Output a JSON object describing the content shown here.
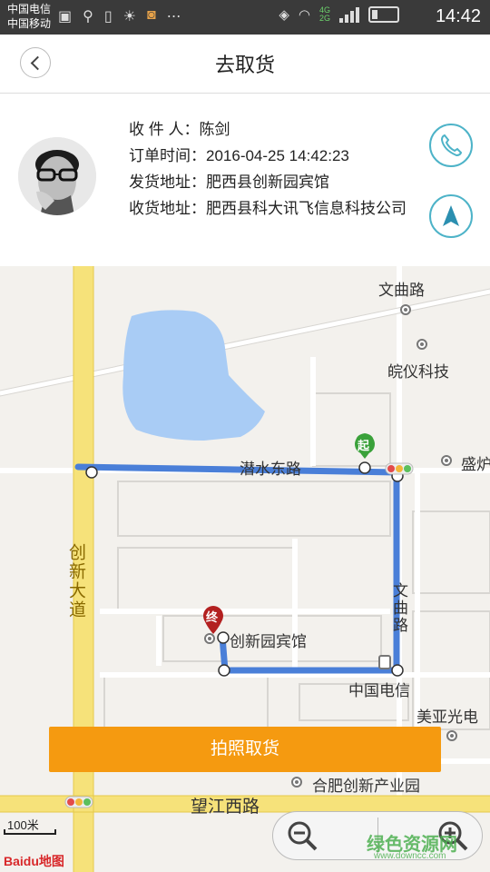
{
  "status_bar": {
    "carrier_1": "中国电信",
    "carrier_2": "中国移动",
    "time": "14:42",
    "network_badges": [
      "4G",
      "2G"
    ]
  },
  "header": {
    "title": "去取货",
    "back_icon": "chevron-left-icon"
  },
  "order": {
    "recipient_label": "收 件 人：",
    "recipient": "陈剑",
    "order_time_label": "订单时间：",
    "order_time": "2016-04-25 14:42:23",
    "ship_address_label": "发货地址：",
    "ship_address": "肥西县创新园宾馆",
    "receive_address_label": "收货地址：",
    "receive_address": "肥西县科大讯飞信息科技公司"
  },
  "actions": {
    "call_icon": "phone-icon",
    "navigate_icon": "navigation-arrow-icon",
    "primary_button": "拍照取货"
  },
  "map": {
    "labels": {
      "wenqu_road_top": "文曲路",
      "wanyi_tech": "皖仪科技",
      "shengjia": "盛炉",
      "qianshui_east_road": "潜水东路",
      "chuangxin_avenue": "创新大道",
      "wenqu_road_side": "文曲路",
      "chuangxin_hotel": "创新园宾馆",
      "china_telecom": "中国电信",
      "meiya_optoelectric": "美亚光电",
      "hefei_innovation_park": "合肥创新产业园",
      "wangjiang_west_road": "望江西路"
    },
    "markers": {
      "start": "起",
      "end": "终"
    },
    "scale": "100米",
    "logo": "Baidu地图",
    "watermark": "绿色资源网",
    "watermark_url": "www.downcc.com",
    "colors": {
      "route": "#4a7fd8",
      "water": "#a9ccf5",
      "major_road": "#f6e27a",
      "start_marker": "#3aa13a",
      "end_marker": "#b32020",
      "button": "#f59a10"
    }
  }
}
